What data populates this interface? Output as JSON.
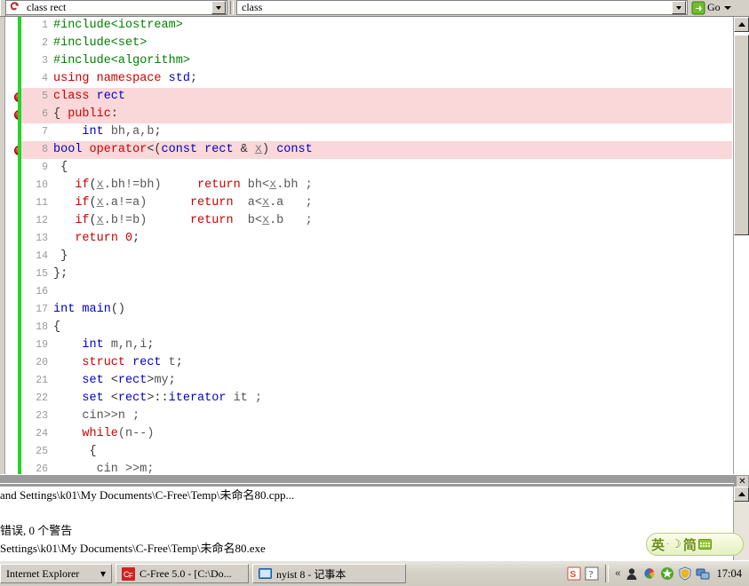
{
  "toolbar": {
    "scope_combo": {
      "value": "class rect",
      "icon": "class-icon"
    },
    "member_combo": {
      "value": "class",
      "icon": "member-icon"
    },
    "go_button": {
      "label": "Go",
      "icon": "go-icon"
    }
  },
  "editor": {
    "lines": [
      {
        "num": "1",
        "breakpoint": false,
        "highlight": false,
        "changed": true,
        "tokens": [
          {
            "t": "#include<iostream>",
            "c": "k-pre"
          }
        ]
      },
      {
        "num": "2",
        "breakpoint": false,
        "highlight": false,
        "changed": true,
        "tokens": [
          {
            "t": "#include<set>",
            "c": "k-pre"
          }
        ]
      },
      {
        "num": "3",
        "breakpoint": false,
        "highlight": false,
        "changed": true,
        "tokens": [
          {
            "t": "#include<algorithm>",
            "c": "k-pre"
          }
        ]
      },
      {
        "num": "4",
        "breakpoint": false,
        "highlight": false,
        "changed": true,
        "tokens": [
          {
            "t": "using namespace ",
            "c": "k-kw"
          },
          {
            "t": "std",
            "c": "k-type"
          },
          {
            "t": ";",
            "c": "k-plain"
          }
        ]
      },
      {
        "num": "5",
        "breakpoint": true,
        "highlight": true,
        "changed": true,
        "tokens": [
          {
            "t": "class ",
            "c": "k-kw"
          },
          {
            "t": "rect",
            "c": "k-type"
          }
        ]
      },
      {
        "num": "6",
        "breakpoint": true,
        "highlight": true,
        "changed": true,
        "tokens": [
          {
            "t": "{ ",
            "c": "k-plain"
          },
          {
            "t": "public",
            "c": "k-kw"
          },
          {
            "t": ":",
            "c": "k-plain"
          }
        ]
      },
      {
        "num": "7",
        "breakpoint": false,
        "highlight": false,
        "changed": true,
        "tokens": [
          {
            "t": "    ",
            "c": "k-plain"
          },
          {
            "t": "int",
            "c": "k-type"
          },
          {
            "t": " ",
            "c": "k-plain"
          },
          {
            "t": "bh,a,b",
            "c": "k-id"
          },
          {
            "t": ";",
            "c": "k-plain"
          }
        ]
      },
      {
        "num": "8",
        "breakpoint": true,
        "highlight": true,
        "changed": true,
        "tokens": [
          {
            "t": "bool",
            "c": "k-type"
          },
          {
            "t": " ",
            "c": "k-plain"
          },
          {
            "t": "operator",
            "c": "k-kw"
          },
          {
            "t": "<(",
            "c": "k-plain"
          },
          {
            "t": "const",
            "c": "k-type"
          },
          {
            "t": " ",
            "c": "k-plain"
          },
          {
            "t": "rect",
            "c": "k-type"
          },
          {
            "t": " & ",
            "c": "k-plain"
          },
          {
            "t": "x",
            "c": "k-var"
          },
          {
            "t": ") ",
            "c": "k-plain"
          },
          {
            "t": "const",
            "c": "k-type"
          }
        ]
      },
      {
        "num": "9",
        "breakpoint": false,
        "highlight": false,
        "changed": true,
        "tokens": [
          {
            "t": " {",
            "c": "k-plain"
          }
        ]
      },
      {
        "num": "10",
        "breakpoint": false,
        "highlight": false,
        "changed": true,
        "tokens": [
          {
            "t": "   ",
            "c": "k-plain"
          },
          {
            "t": "if",
            "c": "k-kw"
          },
          {
            "t": "(",
            "c": "k-plain"
          },
          {
            "t": "x",
            "c": "k-var"
          },
          {
            "t": ".bh!=bh)     ",
            "c": "k-id"
          },
          {
            "t": "return",
            "c": "k-kw"
          },
          {
            "t": " bh<",
            "c": "k-id"
          },
          {
            "t": "x",
            "c": "k-var"
          },
          {
            "t": ".bh ;",
            "c": "k-id"
          }
        ]
      },
      {
        "num": "11",
        "breakpoint": false,
        "highlight": false,
        "changed": true,
        "tokens": [
          {
            "t": "   ",
            "c": "k-plain"
          },
          {
            "t": "if",
            "c": "k-kw"
          },
          {
            "t": "(",
            "c": "k-plain"
          },
          {
            "t": "x",
            "c": "k-var"
          },
          {
            "t": ".a!=a)      ",
            "c": "k-id"
          },
          {
            "t": "return",
            "c": "k-kw"
          },
          {
            "t": "  a<",
            "c": "k-id"
          },
          {
            "t": "x",
            "c": "k-var"
          },
          {
            "t": ".a   ;",
            "c": "k-id"
          }
        ]
      },
      {
        "num": "12",
        "breakpoint": false,
        "highlight": false,
        "changed": true,
        "tokens": [
          {
            "t": "   ",
            "c": "k-plain"
          },
          {
            "t": "if",
            "c": "k-kw"
          },
          {
            "t": "(",
            "c": "k-plain"
          },
          {
            "t": "x",
            "c": "k-var"
          },
          {
            "t": ".b!=b)      ",
            "c": "k-id"
          },
          {
            "t": "return",
            "c": "k-kw"
          },
          {
            "t": "  b<",
            "c": "k-id"
          },
          {
            "t": "x",
            "c": "k-var"
          },
          {
            "t": ".b   ;",
            "c": "k-id"
          }
        ]
      },
      {
        "num": "13",
        "breakpoint": false,
        "highlight": false,
        "changed": true,
        "tokens": [
          {
            "t": "   ",
            "c": "k-plain"
          },
          {
            "t": "return",
            "c": "k-kw"
          },
          {
            "t": " ",
            "c": "k-plain"
          },
          {
            "t": "0",
            "c": "k-num"
          },
          {
            "t": ";",
            "c": "k-plain"
          }
        ]
      },
      {
        "num": "14",
        "breakpoint": false,
        "highlight": false,
        "changed": true,
        "tokens": [
          {
            "t": " }",
            "c": "k-plain"
          }
        ]
      },
      {
        "num": "15",
        "breakpoint": false,
        "highlight": false,
        "changed": true,
        "tokens": [
          {
            "t": "};",
            "c": "k-plain"
          }
        ]
      },
      {
        "num": "16",
        "breakpoint": false,
        "highlight": false,
        "changed": true,
        "tokens": [
          {
            "t": "",
            "c": "k-plain"
          }
        ]
      },
      {
        "num": "17",
        "breakpoint": false,
        "highlight": false,
        "changed": true,
        "tokens": [
          {
            "t": "int",
            "c": "k-type"
          },
          {
            "t": " ",
            "c": "k-plain"
          },
          {
            "t": "main",
            "c": "k-type"
          },
          {
            "t": "()",
            "c": "k-plain"
          }
        ]
      },
      {
        "num": "18",
        "breakpoint": false,
        "highlight": false,
        "changed": true,
        "tokens": [
          {
            "t": "{",
            "c": "k-plain"
          }
        ]
      },
      {
        "num": "19",
        "breakpoint": false,
        "highlight": false,
        "changed": true,
        "tokens": [
          {
            "t": "    ",
            "c": "k-plain"
          },
          {
            "t": "int",
            "c": "k-type"
          },
          {
            "t": " ",
            "c": "k-plain"
          },
          {
            "t": "m,n,i",
            "c": "k-id"
          },
          {
            "t": ";",
            "c": "k-plain"
          }
        ]
      },
      {
        "num": "20",
        "breakpoint": false,
        "highlight": false,
        "changed": true,
        "tokens": [
          {
            "t": "    ",
            "c": "k-plain"
          },
          {
            "t": "struct",
            "c": "k-kw"
          },
          {
            "t": " ",
            "c": "k-plain"
          },
          {
            "t": "rect",
            "c": "k-type"
          },
          {
            "t": " ",
            "c": "k-plain"
          },
          {
            "t": "t",
            "c": "k-id"
          },
          {
            "t": ";",
            "c": "k-plain"
          }
        ]
      },
      {
        "num": "21",
        "breakpoint": false,
        "highlight": false,
        "changed": true,
        "tokens": [
          {
            "t": "    ",
            "c": "k-plain"
          },
          {
            "t": "set",
            "c": "k-type"
          },
          {
            "t": " <",
            "c": "k-plain"
          },
          {
            "t": "rect",
            "c": "k-type"
          },
          {
            "t": ">",
            "c": "k-plain"
          },
          {
            "t": "my",
            "c": "k-id"
          },
          {
            "t": ";",
            "c": "k-plain"
          }
        ]
      },
      {
        "num": "22",
        "breakpoint": false,
        "highlight": false,
        "changed": true,
        "tokens": [
          {
            "t": "    ",
            "c": "k-plain"
          },
          {
            "t": "set",
            "c": "k-type"
          },
          {
            "t": " <",
            "c": "k-plain"
          },
          {
            "t": "rect",
            "c": "k-type"
          },
          {
            "t": ">::",
            "c": "k-plain"
          },
          {
            "t": "iterator",
            "c": "k-type"
          },
          {
            "t": " ",
            "c": "k-plain"
          },
          {
            "t": "it ;",
            "c": "k-id"
          }
        ]
      },
      {
        "num": "23",
        "breakpoint": false,
        "highlight": false,
        "changed": true,
        "tokens": [
          {
            "t": "    ",
            "c": "k-plain"
          },
          {
            "t": "cin>>n ;",
            "c": "k-id"
          }
        ]
      },
      {
        "num": "24",
        "breakpoint": false,
        "highlight": false,
        "changed": true,
        "tokens": [
          {
            "t": "    ",
            "c": "k-plain"
          },
          {
            "t": "while",
            "c": "k-kw"
          },
          {
            "t": "(n--)",
            "c": "k-id"
          }
        ]
      },
      {
        "num": "25",
        "breakpoint": false,
        "highlight": false,
        "changed": true,
        "tokens": [
          {
            "t": "     {",
            "c": "k-plain"
          }
        ]
      },
      {
        "num": "26",
        "breakpoint": false,
        "highlight": false,
        "changed": true,
        "tokens": [
          {
            "t": "      cin >>m;",
            "c": "k-id"
          }
        ]
      }
    ]
  },
  "output": {
    "lines": [
      "and Settings\\k01\\My Documents\\C-Free\\Temp\\未命名80.cpp...",
      "",
      "错误, 0 个警告",
      "Settings\\k01\\My Documents\\C-Free\\Temp\\未命名80.exe"
    ]
  },
  "ime": {
    "mode_label": "英",
    "separator": "·",
    "moon": "☽",
    "shape_label": "简",
    "keyboard_icon": "soft-keyboard-icon"
  },
  "taskbar": {
    "buttons": [
      {
        "label": "Internet Explorer",
        "icon": "ie-group-icon",
        "dropdown": "▾"
      },
      {
        "label": "C-Free 5.0 - [C:\\Do...",
        "icon": "cfree-icon",
        "dropdown": ""
      },
      {
        "label": "nyist 8 - 记事本",
        "icon": "notepad-icon",
        "dropdown": ""
      }
    ],
    "tray": {
      "chevron": "«",
      "icons": [
        "sogou-icon",
        "help-icon",
        "user-icon",
        "color-pinwheel-icon",
        "green-star-icon",
        "shield-icon",
        "network-icon"
      ],
      "time": "17:04"
    }
  },
  "colors": {
    "highlight_pink": "#fad7d9",
    "keyword_red": "#cc0000",
    "type_blue": "#0000cc",
    "preprocessor_green": "#008000",
    "change_bar_green": "#25d425",
    "chrome_gray": "#d4d0c8"
  }
}
